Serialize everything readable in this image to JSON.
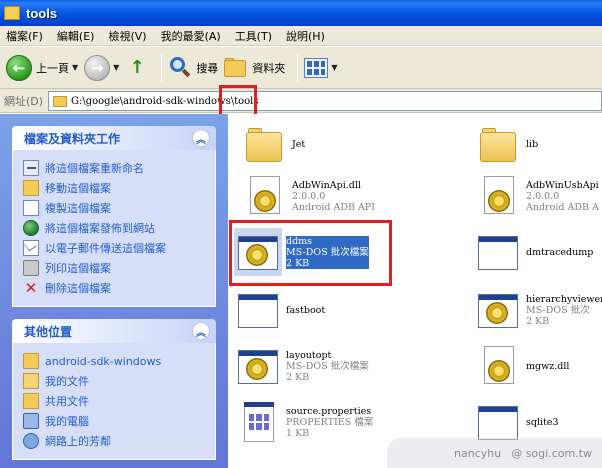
{
  "window": {
    "title": "tools"
  },
  "menu": [
    "檔案(F)",
    "編輯(E)",
    "檢視(V)",
    "我的最愛(A)",
    "工具(T)",
    "說明(H)"
  ],
  "toolbar": {
    "back_label": "上一頁",
    "search_label": "搜尋",
    "folders_label": "資料夾"
  },
  "address": {
    "label": "網址(D)",
    "path": "G:\\google\\android-sdk-windows\\tools"
  },
  "taskpane": {
    "file_tasks": {
      "title": "檔案及資料夾工作",
      "items": [
        "將這個檔案重新命名",
        "移動這個檔案",
        "複製這個檔案",
        "將這個檔案發佈到網站",
        "以電子郵件傳送這個檔案",
        "列印這個檔案",
        "刪除這個檔案"
      ]
    },
    "other_places": {
      "title": "其他位置",
      "items": [
        "android-sdk-windows",
        "我的文件",
        "共用文件",
        "我的電腦",
        "網路上的芳鄰"
      ]
    }
  },
  "files": [
    {
      "name": "Jet",
      "line2": "",
      "line3": "",
      "icon": "folder-icon"
    },
    {
      "name": "lib",
      "line2": "",
      "line3": "",
      "icon": "folder-icon"
    },
    {
      "name": "AdbWinApi.dll",
      "line2": "2.0.0.0",
      "line3": "Android ADB API",
      "icon": "dll-icon"
    },
    {
      "name": "AdbWinUsbApi",
      "line2": "2.0.0.0",
      "line3": "Android ADB A",
      "icon": "dll-icon"
    },
    {
      "name": "ddms",
      "line2": "MS-DOS 批次檔案",
      "line3": "2 KB",
      "icon": "batch-file-icon",
      "selected": true
    },
    {
      "name": "dmtracedump",
      "line2": "",
      "line3": "",
      "icon": "exe-icon"
    },
    {
      "name": "fastboot",
      "line2": "",
      "line3": "",
      "icon": "exe-icon"
    },
    {
      "name": "hierarchyviewer",
      "line2": "MS-DOS 批次",
      "line3": "2 KB",
      "icon": "batch-file-icon"
    },
    {
      "name": "layoutopt",
      "line2": "MS-DOS 批次檔案",
      "line3": "2 KB",
      "icon": "batch-file-icon"
    },
    {
      "name": "mgwz.dll",
      "line2": "",
      "line3": "",
      "icon": "dll-icon"
    },
    {
      "name": "source.properties",
      "line2": "PROPERTIES 檔案",
      "line3": "1 KB",
      "icon": "properties-file-icon"
    },
    {
      "name": "sqlite3",
      "line2": "",
      "line3": "",
      "icon": "exe-icon"
    }
  ],
  "watermark": {
    "user": "nancyhu",
    "site": "@ sogi.com.tw"
  },
  "colors": {
    "titlebar": "#0054e3",
    "highlight": "#e21e1e",
    "selection": "#316ac5",
    "task_link": "#215dc6"
  }
}
